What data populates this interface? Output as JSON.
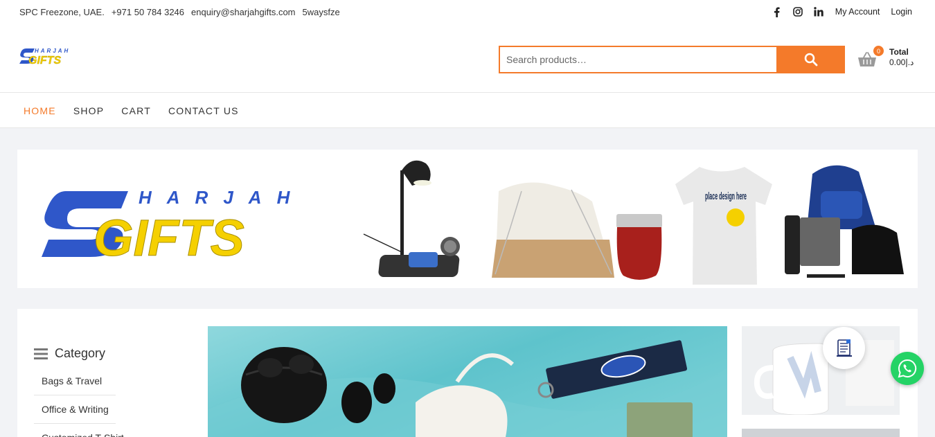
{
  "topbar": {
    "location": "SPC Freezone, UAE.",
    "phone": "+971 50 784 3246",
    "email": "enquiry@sharjahgifts.com",
    "handle": "5waysfze",
    "social": [
      "facebook-icon",
      "instagram-icon",
      "linkedin-icon"
    ],
    "my_account": "My Account",
    "login": "Login"
  },
  "header": {
    "logo_top": "HARJAH",
    "logo_bottom": "GIFTS",
    "search_placeholder": "Search products…",
    "cart_count": "0",
    "cart_total_label": "Total",
    "cart_total_value": "0.00د.إ"
  },
  "nav": {
    "items": [
      "HOME",
      "SHOP",
      "CART",
      "CONTACT US"
    ],
    "active": "HOME"
  },
  "banner": {
    "logo_top": "HARJAH",
    "logo_bottom": "GIFTS",
    "tshirt_text": "place design here"
  },
  "sidebar": {
    "title": "Category",
    "items": [
      "Bags & Travel",
      "Office & Writing",
      "Customized T-Shirt"
    ]
  },
  "colors": {
    "accent": "#f47a2a",
    "logo_blue": "#2f57c9",
    "logo_yellow": "#f5d000",
    "whatsapp": "#25d366"
  }
}
